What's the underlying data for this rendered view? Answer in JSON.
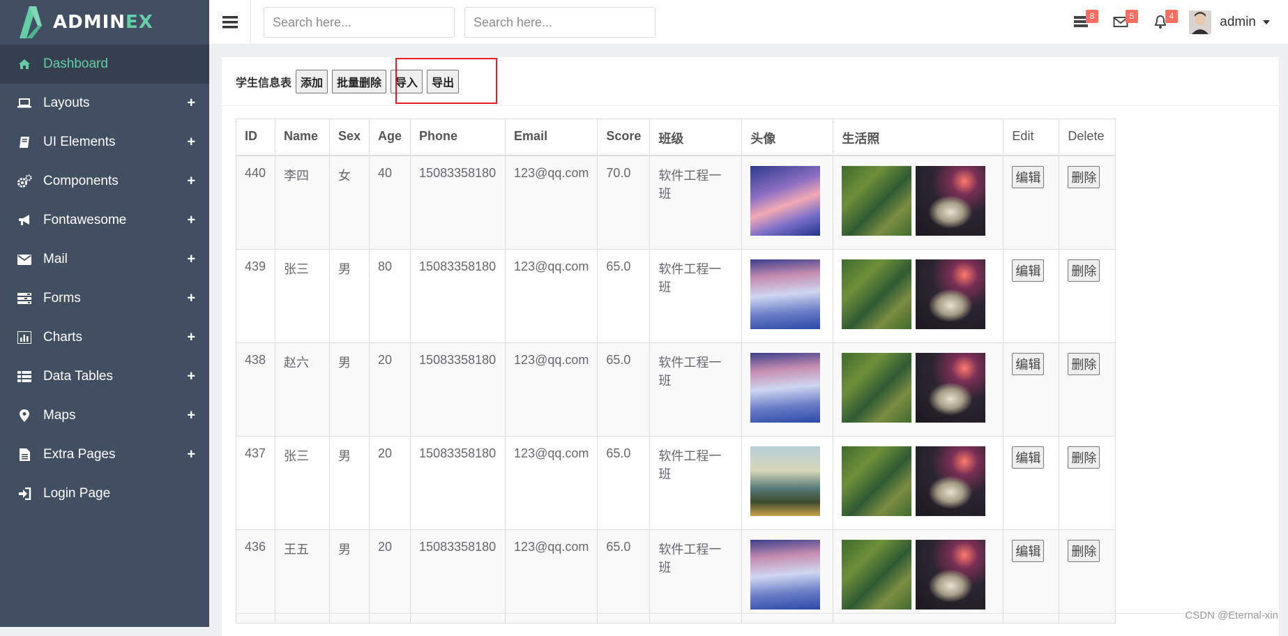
{
  "brand": {
    "name_main": "ADMIN",
    "name_accent": "EX"
  },
  "sidebar": {
    "items": [
      {
        "label": "Dashboard",
        "icon": "home-icon",
        "active": true,
        "expandable": false
      },
      {
        "label": "Layouts",
        "icon": "laptop-icon",
        "active": false,
        "expandable": true
      },
      {
        "label": "UI Elements",
        "icon": "book-icon",
        "active": false,
        "expandable": true
      },
      {
        "label": "Components",
        "icon": "cogs-icon",
        "active": false,
        "expandable": true
      },
      {
        "label": "Fontawesome",
        "icon": "bullhorn-icon",
        "active": false,
        "expandable": true
      },
      {
        "label": "Mail",
        "icon": "envelope-icon",
        "active": false,
        "expandable": true
      },
      {
        "label": "Forms",
        "icon": "tasks-icon",
        "active": false,
        "expandable": true
      },
      {
        "label": "Charts",
        "icon": "bar-chart-icon",
        "active": false,
        "expandable": true
      },
      {
        "label": "Data Tables",
        "icon": "table-icon",
        "active": false,
        "expandable": true
      },
      {
        "label": "Maps",
        "icon": "map-marker-icon",
        "active": false,
        "expandable": true
      },
      {
        "label": "Extra Pages",
        "icon": "file-icon",
        "active": false,
        "expandable": true
      },
      {
        "label": "Login Page",
        "icon": "sign-in-icon",
        "active": false,
        "expandable": false
      }
    ],
    "plus_symbol": "+"
  },
  "header": {
    "search1_placeholder": "Search here...",
    "search2_placeholder": "Search here...",
    "tasks_badge": "8",
    "mail_badge": "5",
    "notifications_badge": "4",
    "username": "admin"
  },
  "panel": {
    "title": "学生信息表",
    "buttons": {
      "add": "添加",
      "batch_delete": "批量删除",
      "import": "导入",
      "export": "导出"
    }
  },
  "table": {
    "headers": [
      "ID",
      "Name",
      "Sex",
      "Age",
      "Phone",
      "Email",
      "Score",
      "班级",
      "头像",
      "生活照",
      "Edit",
      "Delete"
    ],
    "edit_label": "编辑",
    "delete_label": "删除",
    "rows": [
      {
        "id": "440",
        "name": "李四",
        "sex": "女",
        "age": "40",
        "phone": "15083358180",
        "email": "123@qq.com",
        "score": "70.0",
        "class": "软件工程一班",
        "avatar": "clouds"
      },
      {
        "id": "439",
        "name": "张三",
        "sex": "男",
        "age": "80",
        "phone": "15083358180",
        "email": "123@qq.com",
        "score": "65.0",
        "class": "软件工程一班",
        "avatar": "snow"
      },
      {
        "id": "438",
        "name": "赵六",
        "sex": "男",
        "age": "20",
        "phone": "15083358180",
        "email": "123@qq.com",
        "score": "65.0",
        "class": "软件工程一班",
        "avatar": "snow"
      },
      {
        "id": "437",
        "name": "张三",
        "sex": "男",
        "age": "20",
        "phone": "15083358180",
        "email": "123@qq.com",
        "score": "65.0",
        "class": "软件工程一班",
        "avatar": "island"
      },
      {
        "id": "436",
        "name": "王五",
        "sex": "男",
        "age": "20",
        "phone": "15083358180",
        "email": "123@qq.com",
        "score": "65.0",
        "class": "软件工程一班",
        "avatar": "snow"
      }
    ]
  },
  "watermark": "CSDN @Eternal-xin",
  "colors": {
    "sidebar_bg": "#424f63",
    "active_bg": "#353f4f",
    "accent": "#65cea7",
    "badge": "#ff6c60",
    "highlight": "#e8191f"
  }
}
